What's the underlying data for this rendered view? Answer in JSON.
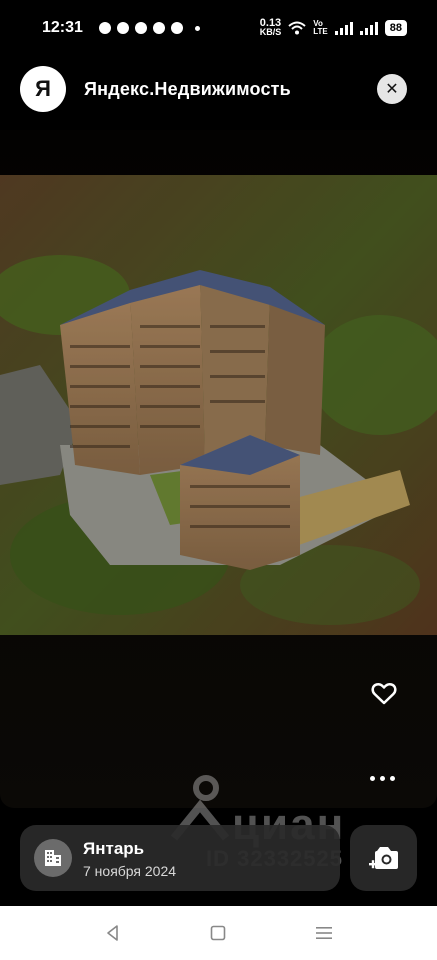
{
  "status_bar": {
    "time": "12:31",
    "net_speed_value": "0.13",
    "net_speed_unit": "KB/S",
    "volte_top": "Vo",
    "volte_bottom": "LTE",
    "battery": "88",
    "notification_icons": [
      "facebook-icon",
      "facebook-icon",
      "messenger-icon",
      "telegram-icon",
      "rss-icon"
    ]
  },
  "header": {
    "logo_letter": "Я",
    "app_title": "Яндекс.Недвижимость",
    "close_icon": "close-icon"
  },
  "photo": {
    "subject": "residential-complex-render"
  },
  "watermark": {
    "brand": "циан",
    "id_text": "ID 32332525"
  },
  "card": {
    "title": "Янтарь",
    "date": "7 ноября 2024",
    "icon": "building-icon"
  },
  "actions": {
    "favorite_icon": "heart-icon",
    "more_icon": "more-icon",
    "camera_icon": "camera-plus-icon"
  },
  "nav": {
    "back_icon": "back-icon",
    "home_icon": "home-icon",
    "recents_icon": "recents-icon"
  },
  "colors": {
    "background": "#000000",
    "card_background": "#2a2a2a",
    "accent": "#ffffff"
  }
}
